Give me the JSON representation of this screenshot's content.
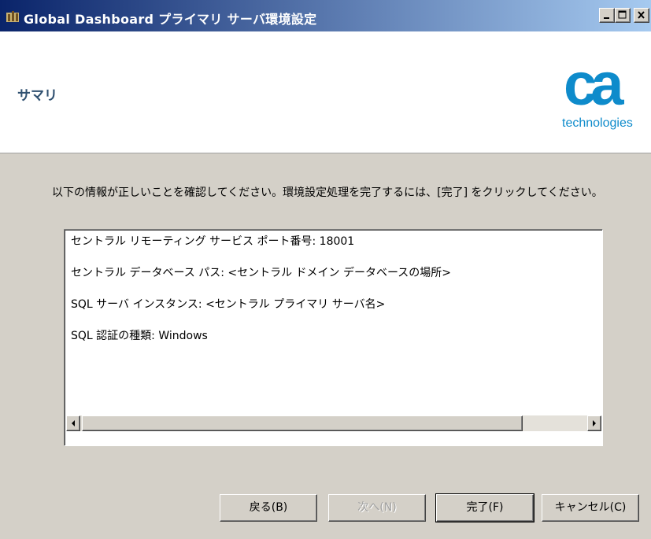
{
  "window": {
    "title": "Global Dashboard プライマリ サーバ環境設定",
    "controls": [
      "minimize-icon",
      "maximize-icon",
      "close-icon"
    ]
  },
  "header": {
    "page_title": "サマリ",
    "logo": {
      "letters": "ca",
      "tagline": "technologies",
      "color": "#0e8bcb"
    }
  },
  "instruction": "以下の情報が正しいことを確認してください。環境設定処理を完了するには、[完了] をクリックしてください。",
  "summary": {
    "lines": [
      "セントラル リモーティング サービス ポート番号: 18001",
      "セントラル データベース パス: <セントラル ドメイン データベースの場所>",
      "SQL サーバ インスタンス: <セントラル プライマリ サーバ名>",
      "SQL 認証の種類: Windows"
    ]
  },
  "buttons": {
    "back": "戻る(B)",
    "next": "次へ(N)",
    "finish": "完了(F)",
    "cancel": "キャンセル(C)"
  },
  "colors": {
    "title_bar": "#0a246a",
    "accent": "#0e8bcb",
    "dialog_bg": "#d4d0c8"
  }
}
